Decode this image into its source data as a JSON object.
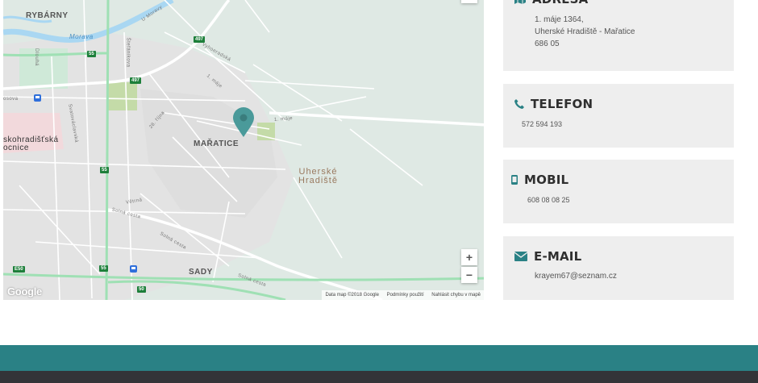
{
  "map": {
    "places": {
      "rybarny": "RYBÁRNY",
      "maratice": "MAŘATICE",
      "sady": "SADY",
      "uherske_hradiste_1": "Uherské",
      "uherske_hradiste_2": "Hradiště",
      "hospital_1": "skohradišťská",
      "hospital_2": "ocnice",
      "osova": "osova"
    },
    "streets": {
      "morava": "Morava",
      "u_moravy": "U Moravy",
      "vychodni": "Východní",
      "stefanikova": "Štefánikova",
      "dlouha": "Dlouhá",
      "svatovaclavska": "Svatováclavská",
      "octobra": "28. října",
      "maje1": "1. máje",
      "maje2": "1. máje",
      "vysocanka": "Vyhoeradská",
      "solna1": "Solná cesta",
      "solna2": "Solná cesta",
      "solna3": "Solná cesta",
      "vetrna": "Větrná"
    },
    "shields": {
      "r497a": "497",
      "r497b": "497",
      "r55a": "55",
      "r55b": "55",
      "r55c": "55",
      "r50": "50",
      "e50": "E50"
    },
    "zoom_in": "+",
    "zoom_out": "−",
    "google": "Google",
    "attribution": {
      "data": "Data map ©2018 Google",
      "terms": "Podmínky použití",
      "report": "Nahlásit chybu v mapě"
    }
  },
  "contacts": {
    "address": {
      "title": "ADRESA",
      "line1": "1. máje 1364,",
      "line2": "Uherské Hradiště - Mařatice",
      "line3": "686 05"
    },
    "phone": {
      "title": "TELEFON",
      "value": "572 594 193"
    },
    "mobile": {
      "title": "MOBIL",
      "value": "608 08 08 25"
    },
    "email": {
      "title": "E-MAIL",
      "value": "krayem67@seznam.cz"
    }
  },
  "colors": {
    "accent": "#2a8185",
    "footer_dark": "#333438",
    "card_bg": "#eeeeee",
    "pin": "#4a9a9a"
  },
  "icons": {
    "address": "map-icon",
    "phone": "phone-icon",
    "mobile": "mobile-icon",
    "email": "envelope-icon",
    "pin": "map-pin-icon"
  }
}
